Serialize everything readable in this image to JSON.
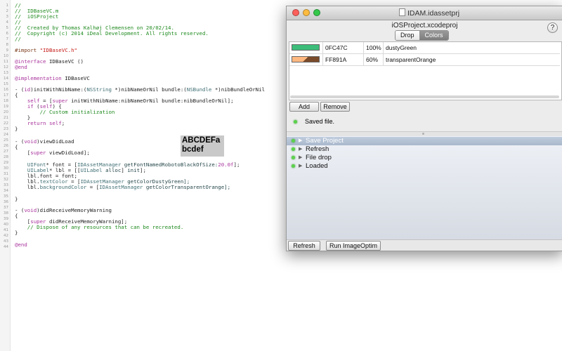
{
  "editor": {
    "line_numbers": [
      "1",
      "2",
      "3",
      "4",
      "5",
      "6",
      "7",
      "8",
      "9",
      "10",
      "11",
      "12",
      "13",
      "14",
      "15",
      "16",
      "17",
      "18",
      "19",
      "20",
      "21",
      "22",
      "23",
      "24",
      "25",
      "26",
      "27",
      "28",
      "29",
      "30",
      "31",
      "32",
      "33",
      "34",
      "35",
      "36",
      "37",
      "38",
      "39",
      "40",
      "41",
      "42",
      "43",
      "44"
    ],
    "lines": {
      "l1": "//",
      "l2": "//  IDBaseVC.m",
      "l3": "//  iOSProject",
      "l4": "//",
      "l5": "//  Created by Thomas Kalhøj Clemensen on 20/02/14.",
      "l6": "//  Copyright (c) 2014 iDeal Development. All rights reserved.",
      "l7": "//",
      "l9_a": "#import ",
      "l9_b": "\"IDBaseVC.h\"",
      "l11_a": "@interface",
      "l11_b": " IDBaseVC ()",
      "l12": "@end",
      "l14_a": "@implementation",
      "l14_b": " IDBaseVC",
      "l16_a": "- (",
      "l16_b": "id",
      "l16_c": ")initWithNibName:(",
      "l16_d": "NSString",
      "l16_e": " *)nibNameOrNil bundle:(",
      "l16_f": "NSBundle",
      "l16_g": " *)nibBundleOrNil",
      "l17": "{",
      "l18_a": "    ",
      "l18_b": "self",
      "l18_c": " = [",
      "l18_d": "super",
      "l18_e": " initWithNibName:nibNameOrNil bundle:nibBundleOrNil];",
      "l19_a": "    ",
      "l19_b": "if",
      "l19_c": " (",
      "l19_d": "self",
      "l19_e": ") {",
      "l20": "        // Custom initialization",
      "l21": "    }",
      "l22_a": "    ",
      "l22_b": "return",
      "l22_c": " ",
      "l22_d": "self",
      "l22_e": ";",
      "l23": "}",
      "l25_a": "- (",
      "l25_b": "void",
      "l25_c": ")viewDidLoad",
      "l26": "{",
      "l27_a": "    [",
      "l27_b": "super",
      "l27_c": " viewDidLoad];",
      "l29_a": "    ",
      "l29_b": "UIFont",
      "l29_c": "* font = [",
      "l29_d": "IDAssetManager",
      "l29_e": " getFontNamedRobotoBlackOfSize:",
      "l29_f": "20.0f",
      "l29_g": "];",
      "l30_a": "    ",
      "l30_b": "UILabel",
      "l30_c": "* lbl = [[",
      "l30_d": "UILabel",
      "l30_e": " ",
      "l30_f": "alloc",
      "l30_g": "] ",
      "l30_h": "init",
      "l30_i": "];",
      "l31": "    lbl.font = font;",
      "l32_a": "    lbl.",
      "l32_b": "textColor",
      "l32_c": " = [",
      "l32_d": "IDAssetManager",
      "l32_e": " getColorDustyGreen];",
      "l33_a": "    lbl.",
      "l33_b": "backgroundColor",
      "l33_c": " = [",
      "l33_d": "IDAssetManager",
      "l33_e": " getColorTransparentOrange];",
      "l35": "}",
      "l37_a": "- (",
      "l37_b": "void",
      "l37_c": ")didReceiveMemoryWarning",
      "l38": "{",
      "l39_a": "    [",
      "l39_b": "super",
      "l39_c": " didReceiveMemoryWarning];",
      "l40": "    // Dispose of any resources that can be recreated.",
      "l41": "}",
      "l43": "@end"
    },
    "sample_label": {
      "text": "ABCDEFa bcdef",
      "background": "#c9c9c9"
    }
  },
  "window": {
    "title": "IDAM.idassetprj",
    "project": "iOSProject.xcodeproj",
    "help_label": "?",
    "tabs": [
      {
        "label": "Drop",
        "active": false
      },
      {
        "label": "Colors",
        "active": true
      }
    ],
    "colors": [
      {
        "hex": "0FC47C",
        "alpha": "100%",
        "name": "dustyGreen",
        "swatch": "#3dbd7a"
      },
      {
        "hex": "FF891A",
        "alpha": "60%",
        "name": "transparentOrange",
        "swatch": "#ffb880"
      }
    ],
    "add_label": "Add",
    "remove_label": "Remove",
    "status_text": "Saved file.",
    "log_items": [
      {
        "label": "Save Project",
        "selected": true
      },
      {
        "label": "Refresh",
        "selected": false
      },
      {
        "label": "File drop",
        "selected": false
      },
      {
        "label": "Loaded",
        "selected": false
      }
    ],
    "refresh_label": "Refresh",
    "imageoptim_label": "Run ImageOptim"
  }
}
